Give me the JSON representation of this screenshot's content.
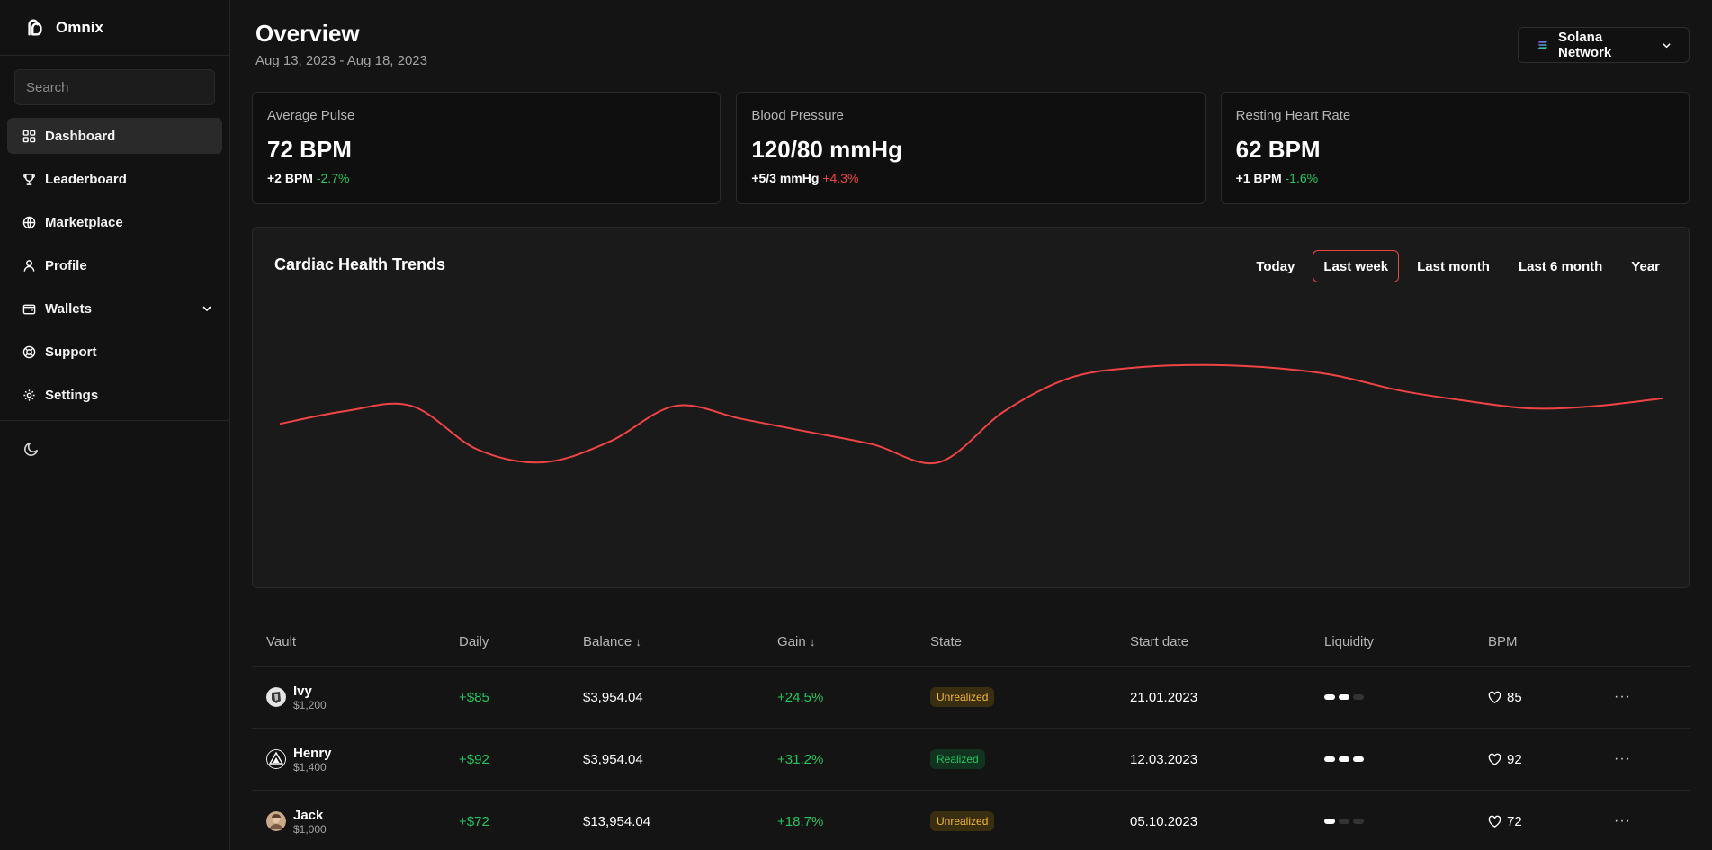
{
  "app": {
    "name": "Omnix"
  },
  "search": {
    "placeholder": "Search"
  },
  "sidebar": {
    "items": [
      {
        "label": "Dashboard",
        "icon": "dashboard-icon",
        "active": true
      },
      {
        "label": "Leaderboard",
        "icon": "trophy-icon"
      },
      {
        "label": "Marketplace",
        "icon": "globe-icon"
      },
      {
        "label": "Profile",
        "icon": "user-icon"
      },
      {
        "label": "Wallets",
        "icon": "wallet-icon",
        "expandable": true
      },
      {
        "label": "Support",
        "icon": "lifebuoy-icon"
      },
      {
        "label": "Settings",
        "icon": "gear-icon"
      }
    ],
    "theme_icon": "moon-icon"
  },
  "header": {
    "title": "Overview",
    "date_range": "Aug 13, 2023 - Aug 18, 2023",
    "network": "Solana Network"
  },
  "stats": [
    {
      "label": "Average Pulse",
      "value": "72 BPM",
      "delta": "+2 BPM",
      "change": "-2.7%",
      "change_color": "#22c55e"
    },
    {
      "label": "Blood Pressure",
      "value": "120/80 mmHg",
      "delta": "+5/3 mmHg",
      "change": "+4.3%",
      "change_color": "#ef4444"
    },
    {
      "label": "Resting Heart Rate",
      "value": "62 BPM",
      "delta": "+1 BPM",
      "change": "-1.6%",
      "change_color": "#22c55e"
    }
  ],
  "chart": {
    "title": "Cardiac Health Trends",
    "ranges": [
      "Today",
      "Last week",
      "Last month",
      "Last 6 month",
      "Year"
    ],
    "active_range": "Last week",
    "line_color": "#ef4444"
  },
  "chart_data": {
    "type": "line",
    "title": "Cardiac Health Trends",
    "xlabel": "",
    "ylabel": "",
    "grid": false,
    "series": [
      {
        "values": [
          55,
          60,
          62,
          45,
          40,
          48,
          62,
          57,
          52,
          47,
          40,
          60,
          73,
          77,
          78,
          77,
          74,
          68,
          64,
          61,
          62,
          65
        ]
      }
    ]
  },
  "table": {
    "columns": [
      "Vault",
      "Daily",
      "Balance",
      "Gain",
      "State",
      "Start date",
      "Liquidity",
      "BPM"
    ],
    "sort_indicator": "↓",
    "rows": [
      {
        "name": "Ivy",
        "amount": "$1,200",
        "daily": "+$85",
        "balance": "$3,954.04",
        "gain": "+24.5%",
        "state": "Unrealized",
        "start": "21.01.2023",
        "liquidity": 2,
        "bpm": "85"
      },
      {
        "name": "Henry",
        "amount": "$1,400",
        "daily": "+$92",
        "balance": "$3,954.04",
        "gain": "+31.2%",
        "state": "Realized",
        "start": "12.03.2023",
        "liquidity": 3,
        "bpm": "92"
      },
      {
        "name": "Jack",
        "amount": "$1,000",
        "daily": "+$72",
        "balance": "$13,954.04",
        "gain": "+18.7%",
        "state": "Unrealized",
        "start": "05.10.2023",
        "liquidity": 1,
        "bpm": "72"
      }
    ],
    "more_label": "···"
  }
}
